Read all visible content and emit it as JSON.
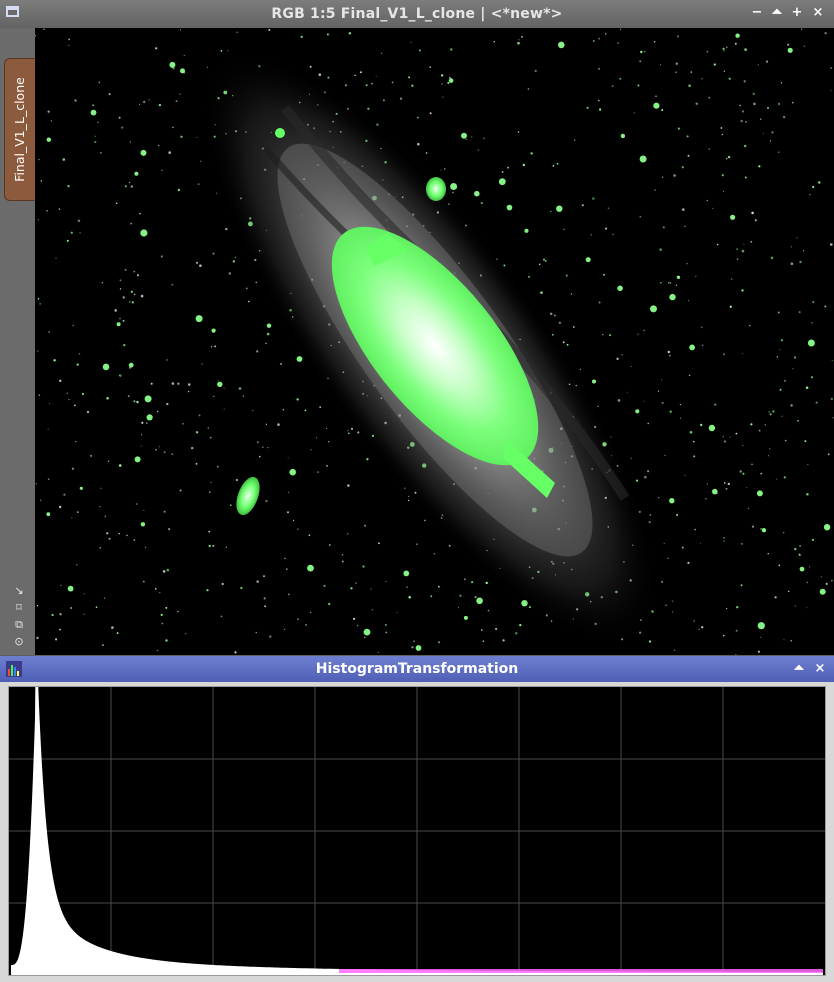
{
  "image_window": {
    "title": "RGB 1:5 Final_V1_L_clone | <*new*>",
    "side_tab_label": "Final_V1_L_clone",
    "controls": {
      "minimize": "−",
      "shade": "⏶",
      "maximize": "+",
      "close": "×"
    },
    "side_tools": [
      "↘",
      "⌑",
      "⧉",
      "⊙"
    ]
  },
  "histogram_window": {
    "title": "HistogramTransformation",
    "controls": {
      "shade": "⏶",
      "close": "×"
    },
    "histogram_color": "#ffffff",
    "clipped_tail_color": "#ff66ff"
  },
  "colors": {
    "highlight": "#66ff66",
    "image_title_bg": "#6f6f6f",
    "tool_title_bg": "#5a6ac0",
    "side_tab": "#8c5a3c"
  }
}
